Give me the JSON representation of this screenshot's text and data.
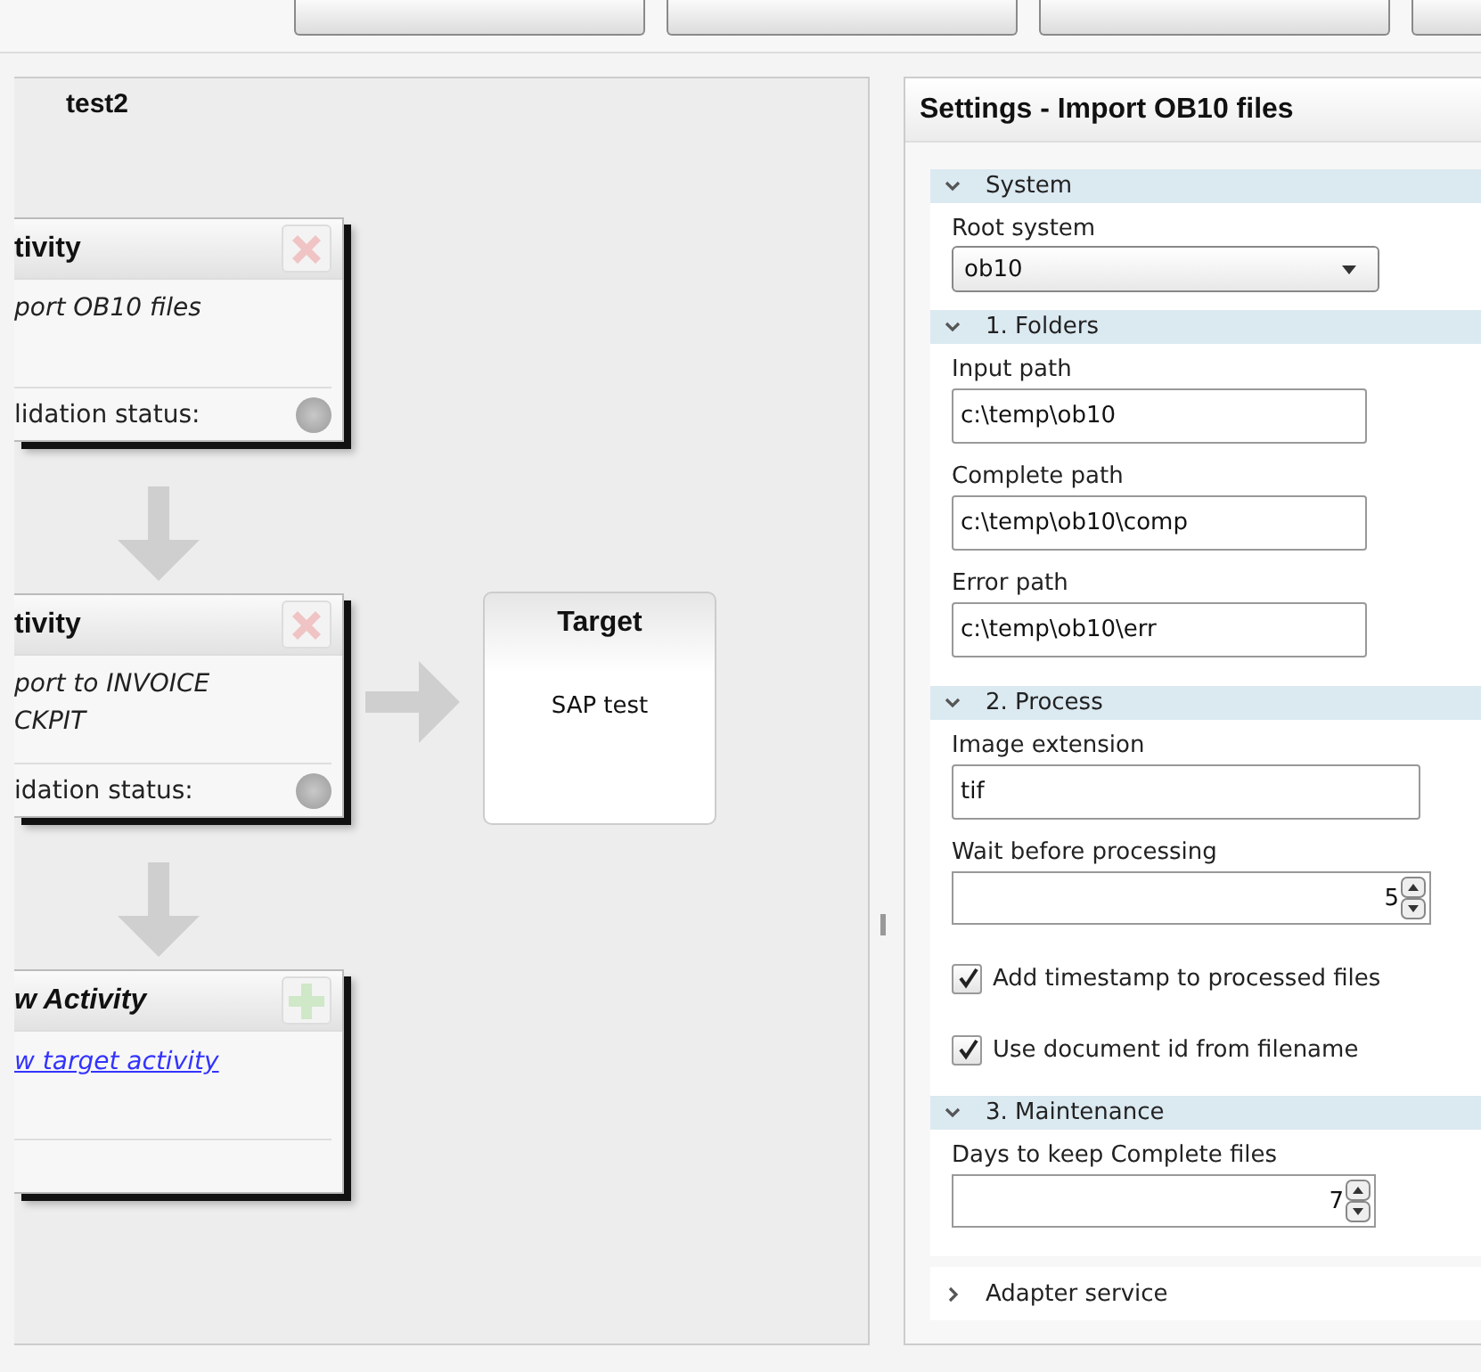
{
  "canvas": {
    "title": "test2",
    "activities": [
      {
        "kind": "activity",
        "title": "tivity",
        "description": [
          "port OB10 files"
        ],
        "status_label": "lidation status:"
      },
      {
        "kind": "activity",
        "title": "tivity",
        "description": [
          "port to INVOICE",
          "CKPIT"
        ],
        "status_label": "idation status:"
      },
      {
        "kind": "new",
        "title": "w Activity",
        "link": "w target activity"
      }
    ],
    "target": {
      "title": "Target",
      "system": "SAP test"
    }
  },
  "settings": {
    "title": "Settings - Import OB10 files",
    "sections": [
      {
        "title": "System",
        "expanded": true,
        "fields": [
          {
            "kind": "select",
            "label": "Root system",
            "value": "ob10"
          }
        ]
      },
      {
        "title": "1. Folders",
        "expanded": true,
        "fields": [
          {
            "kind": "text",
            "label": "Input path",
            "value": "c:\\temp\\ob10"
          },
          {
            "kind": "text",
            "label": "Complete path",
            "value": "c:\\temp\\ob10\\comp"
          },
          {
            "kind": "text",
            "label": "Error path",
            "value": "c:\\temp\\ob10\\err"
          }
        ]
      },
      {
        "title": "2. Process",
        "expanded": true,
        "fields": [
          {
            "kind": "wide",
            "label": "Image extension",
            "value": "tif"
          },
          {
            "kind": "number",
            "label": "Wait before processing",
            "value": "5"
          },
          {
            "kind": "checkbox",
            "label": "Add timestamp to processed files",
            "checked": true
          },
          {
            "kind": "checkbox",
            "label": "Use document id from filename",
            "checked": true
          }
        ]
      },
      {
        "title": "3. Maintenance",
        "expanded": true,
        "fields": [
          {
            "kind": "number",
            "label": "Days to keep Complete files",
            "value": "7"
          }
        ]
      },
      {
        "title": "Adapter service",
        "expanded": false
      }
    ]
  }
}
